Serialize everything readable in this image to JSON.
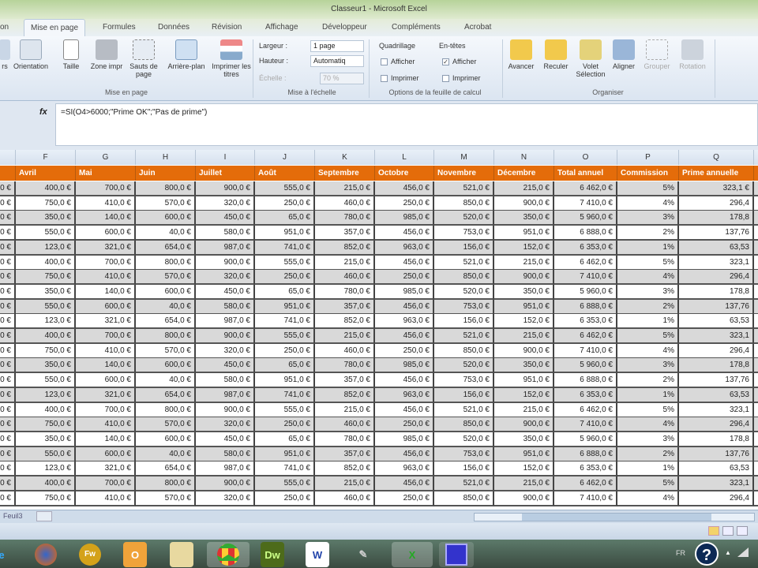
{
  "window": {
    "title": "Classeur1 - Microsoft Excel"
  },
  "tabs": [
    "on",
    "Mise en page",
    "Formules",
    "Données",
    "Révision",
    "Affichage",
    "Développeur",
    "Compléments",
    "Acrobat"
  ],
  "ribbon": {
    "mise_en_page": {
      "buttons": [
        "rs",
        "Orientation",
        "Taille",
        "Zone impr",
        "Sauts de page",
        "Arrière-plan",
        "Imprimer les titres"
      ],
      "label": "Mise en page"
    },
    "echelle": {
      "largeur_label": "Largeur :",
      "largeur_value": "1 page",
      "hauteur_label": "Hauteur :",
      "hauteur_value": "Automatiq",
      "echelle_label": "Échelle :",
      "echelle_value": "70 %",
      "label": "Mise à l'échelle"
    },
    "options": {
      "quadrillage": "Quadrillage",
      "entetes": "En-têtes",
      "afficher": "Afficher",
      "imprimer": "Imprimer",
      "quad_afficher": false,
      "quad_imprimer": false,
      "ent_afficher": true,
      "ent_imprimer": false,
      "label": "Options de la feuille de calcul"
    },
    "organiser": {
      "buttons": [
        "Avancer",
        "Reculer",
        "Volet Sélection",
        "Aligner",
        "Grouper",
        "Rotation"
      ],
      "label": "Organiser"
    }
  },
  "formula_bar": {
    "fx": "fx",
    "formula": "=SI(O4>6000;\"Prime OK\";\"Pas de prime\")"
  },
  "sheet": {
    "col_letters": [
      "",
      "F",
      "G",
      "H",
      "I",
      "J",
      "K",
      "L",
      "M",
      "N",
      "O",
      "P",
      "Q",
      ""
    ],
    "headers": [
      "",
      "Avril",
      "Mai",
      "Juin",
      "Juillet",
      "Août",
      "Septembre",
      "Octobre",
      "Novembre",
      "Décembre",
      "Total annuel",
      "Commission",
      "Prime annuelle",
      ""
    ],
    "rows": [
      [
        "0 €",
        "400,0 €",
        "700,0 €",
        "800,0 €",
        "900,0 €",
        "555,0 €",
        "215,0 €",
        "456,0 €",
        "521,0 €",
        "215,0 €",
        "6 462,0 €",
        "5%",
        "323,1 €"
      ],
      [
        "0 €",
        "750,0 €",
        "410,0 €",
        "570,0 €",
        "320,0 €",
        "250,0 €",
        "460,0 €",
        "250,0 €",
        "850,0 €",
        "900,0 €",
        "7 410,0 €",
        "4%",
        "296,4"
      ],
      [
        "0 €",
        "350,0 €",
        "140,0 €",
        "600,0 €",
        "450,0 €",
        "65,0 €",
        "780,0 €",
        "985,0 €",
        "520,0 €",
        "350,0 €",
        "5 960,0 €",
        "3%",
        "178,8"
      ],
      [
        "0 €",
        "550,0 €",
        "600,0 €",
        "40,0 €",
        "580,0 €",
        "951,0 €",
        "357,0 €",
        "456,0 €",
        "753,0 €",
        "951,0 €",
        "6 888,0 €",
        "2%",
        "137,76"
      ],
      [
        "0 €",
        "123,0 €",
        "321,0 €",
        "654,0 €",
        "987,0 €",
        "741,0 €",
        "852,0 €",
        "963,0 €",
        "156,0 €",
        "152,0 €",
        "6 353,0 €",
        "1%",
        "63,53"
      ],
      [
        "0 €",
        "400,0 €",
        "700,0 €",
        "800,0 €",
        "900,0 €",
        "555,0 €",
        "215,0 €",
        "456,0 €",
        "521,0 €",
        "215,0 €",
        "6 462,0 €",
        "5%",
        "323,1"
      ],
      [
        "0 €",
        "750,0 €",
        "410,0 €",
        "570,0 €",
        "320,0 €",
        "250,0 €",
        "460,0 €",
        "250,0 €",
        "850,0 €",
        "900,0 €",
        "7 410,0 €",
        "4%",
        "296,4"
      ],
      [
        "0 €",
        "350,0 €",
        "140,0 €",
        "600,0 €",
        "450,0 €",
        "65,0 €",
        "780,0 €",
        "985,0 €",
        "520,0 €",
        "350,0 €",
        "5 960,0 €",
        "3%",
        "178,8"
      ],
      [
        "0 €",
        "550,0 €",
        "600,0 €",
        "40,0 €",
        "580,0 €",
        "951,0 €",
        "357,0 €",
        "456,0 €",
        "753,0 €",
        "951,0 €",
        "6 888,0 €",
        "2%",
        "137,76"
      ],
      [
        "0 €",
        "123,0 €",
        "321,0 €",
        "654,0 €",
        "987,0 €",
        "741,0 €",
        "852,0 €",
        "963,0 €",
        "156,0 €",
        "152,0 €",
        "6 353,0 €",
        "1%",
        "63,53"
      ],
      [
        "0 €",
        "400,0 €",
        "700,0 €",
        "800,0 €",
        "900,0 €",
        "555,0 €",
        "215,0 €",
        "456,0 €",
        "521,0 €",
        "215,0 €",
        "6 462,0 €",
        "5%",
        "323,1"
      ],
      [
        "0 €",
        "750,0 €",
        "410,0 €",
        "570,0 €",
        "320,0 €",
        "250,0 €",
        "460,0 €",
        "250,0 €",
        "850,0 €",
        "900,0 €",
        "7 410,0 €",
        "4%",
        "296,4"
      ],
      [
        "0 €",
        "350,0 €",
        "140,0 €",
        "600,0 €",
        "450,0 €",
        "65,0 €",
        "780,0 €",
        "985,0 €",
        "520,0 €",
        "350,0 €",
        "5 960,0 €",
        "3%",
        "178,8"
      ],
      [
        "0 €",
        "550,0 €",
        "600,0 €",
        "40,0 €",
        "580,0 €",
        "951,0 €",
        "357,0 €",
        "456,0 €",
        "753,0 €",
        "951,0 €",
        "6 888,0 €",
        "2%",
        "137,76"
      ],
      [
        "0 €",
        "123,0 €",
        "321,0 €",
        "654,0 €",
        "987,0 €",
        "741,0 €",
        "852,0 €",
        "963,0 €",
        "156,0 €",
        "152,0 €",
        "6 353,0 €",
        "1%",
        "63,53"
      ],
      [
        "0 €",
        "400,0 €",
        "700,0 €",
        "800,0 €",
        "900,0 €",
        "555,0 €",
        "215,0 €",
        "456,0 €",
        "521,0 €",
        "215,0 €",
        "6 462,0 €",
        "5%",
        "323,1"
      ],
      [
        "0 €",
        "750,0 €",
        "410,0 €",
        "570,0 €",
        "320,0 €",
        "250,0 €",
        "460,0 €",
        "250,0 €",
        "850,0 €",
        "900,0 €",
        "7 410,0 €",
        "4%",
        "296,4"
      ],
      [
        "0 €",
        "350,0 €",
        "140,0 €",
        "600,0 €",
        "450,0 €",
        "65,0 €",
        "780,0 €",
        "985,0 €",
        "520,0 €",
        "350,0 €",
        "5 960,0 €",
        "3%",
        "178,8"
      ],
      [
        "0 €",
        "550,0 €",
        "600,0 €",
        "40,0 €",
        "580,0 €",
        "951,0 €",
        "357,0 €",
        "456,0 €",
        "753,0 €",
        "951,0 €",
        "6 888,0 €",
        "2%",
        "137,76"
      ],
      [
        "0 €",
        "123,0 €",
        "321,0 €",
        "654,0 €",
        "987,0 €",
        "741,0 €",
        "852,0 €",
        "963,0 €",
        "156,0 €",
        "152,0 €",
        "6 353,0 €",
        "1%",
        "63,53"
      ],
      [
        "0 €",
        "400,0 €",
        "700,0 €",
        "800,0 €",
        "900,0 €",
        "555,0 €",
        "215,0 €",
        "456,0 €",
        "521,0 €",
        "215,0 €",
        "6 462,0 €",
        "5%",
        "323,1"
      ],
      [
        "0 €",
        "750,0 €",
        "410,0 €",
        "570,0 €",
        "320,0 €",
        "250,0 €",
        "460,0 €",
        "250,0 €",
        "850,0 €",
        "900,0 €",
        "7 410,0 €",
        "4%",
        "296,4"
      ]
    ],
    "sheet_tab": "Feuil3"
  },
  "taskbar": {
    "apps": [
      "e",
      "Firefox",
      "Fw",
      "Outlook",
      "Explorer",
      "Chrome",
      "Dw",
      "W",
      "GIMP",
      "Excel",
      "App"
    ],
    "lang": "FR",
    "help": "?"
  },
  "colors": {
    "header_orange": "#e46c0a",
    "row_gray": "#d9d9d9"
  }
}
